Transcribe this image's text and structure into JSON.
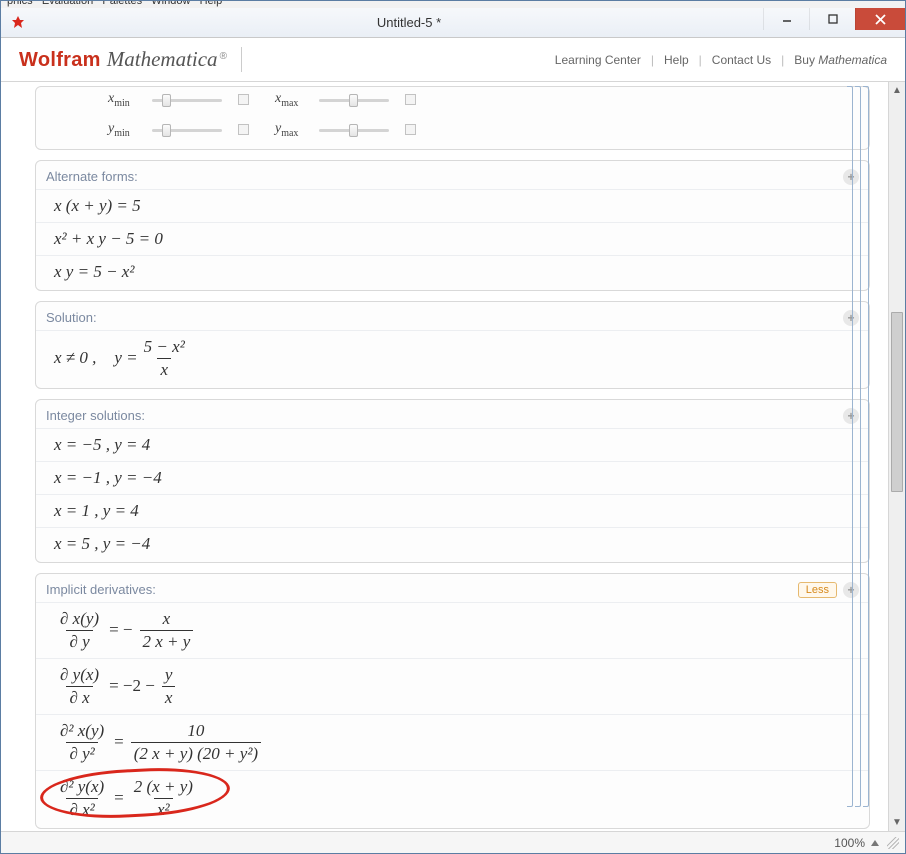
{
  "menubar": {
    "items": [
      "Evaluation",
      "Palettes",
      "Window",
      "Help"
    ]
  },
  "window": {
    "title": "Untitled-5 *"
  },
  "brand": {
    "word1": "Wolfram",
    "word2": "Mathematica"
  },
  "header_links": {
    "learning": "Learning Center",
    "help": "Help",
    "contact": "Contact Us",
    "buy_prefix": "Buy ",
    "buy_product": "Mathematica"
  },
  "sliders": {
    "xmin": "x",
    "xmin_sub": "min",
    "xmax": "x",
    "xmax_sub": "max",
    "ymin": "y",
    "ymin_sub": "min",
    "ymax": "y",
    "ymax_sub": "max"
  },
  "pods": {
    "alternate": {
      "title": "Alternate forms:",
      "rows": [
        "x (x + y) = 5",
        "x² + x y − 5 = 0",
        "x y = 5 − x²"
      ]
    },
    "solution": {
      "title": "Solution:",
      "cond": "x ≠ 0 ,",
      "eq_lhs": "y =",
      "frac_num": "5 − x²",
      "frac_den": "x"
    },
    "integer": {
      "title": "Integer solutions:",
      "rows": [
        "x = −5 ,   y = 4",
        "x = −1 ,   y = −4",
        "x = 1 ,   y = 4",
        "x = 5 ,   y = −4"
      ]
    },
    "derivatives": {
      "title": "Implicit derivatives:",
      "less": "Less",
      "rows": {
        "r1": {
          "lhs_num": "∂ x(y)",
          "lhs_den": "∂ y",
          "eq": "= −",
          "rhs_num": "x",
          "rhs_den": "2 x + y"
        },
        "r2": {
          "lhs_num": "∂ y(x)",
          "lhs_den": "∂ x",
          "eq": "= −2 −",
          "rhs_num": "y",
          "rhs_den": "x"
        },
        "r3": {
          "lhs_num": "∂² x(y)",
          "lhs_den": "∂ y²",
          "eq": "=",
          "rhs_num": "10",
          "rhs_den": "(2 x + y) (20 + y²)"
        },
        "r4": {
          "lhs_num": "∂² y(x)",
          "lhs_den": "∂ x²",
          "eq": "=",
          "rhs_num": "2 (x + y)",
          "rhs_den": "x²"
        }
      }
    }
  },
  "status": {
    "zoom": "100%"
  }
}
